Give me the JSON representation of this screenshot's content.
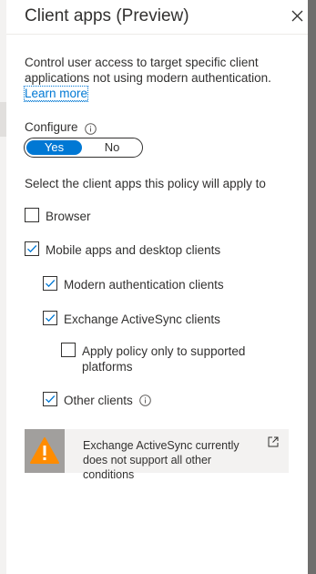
{
  "panel": {
    "title": "Client apps (Preview)",
    "description": "Control user access to target specific client applications not using modern authentication.",
    "learn_more": "Learn more"
  },
  "configure": {
    "label": "Configure",
    "options": [
      "Yes",
      "No"
    ],
    "selected": "Yes"
  },
  "select_label": "Select the client apps this policy will apply to",
  "client_apps": [
    {
      "label": "Browser",
      "checked": false
    },
    {
      "label": "Mobile apps and desktop clients",
      "checked": true
    },
    {
      "label": "Modern authentication clients",
      "checked": true
    },
    {
      "label": "Exchange ActiveSync clients",
      "checked": true
    },
    {
      "label": "Apply policy only to supported platforms",
      "checked": false
    },
    {
      "label": "Other clients",
      "checked": true
    }
  ],
  "warning": {
    "message": "Exchange ActiveSync currently does not support all other conditions"
  },
  "colors": {
    "accent": "#0078d4",
    "warning_orange": "#ff8c00",
    "text": "#323130"
  }
}
